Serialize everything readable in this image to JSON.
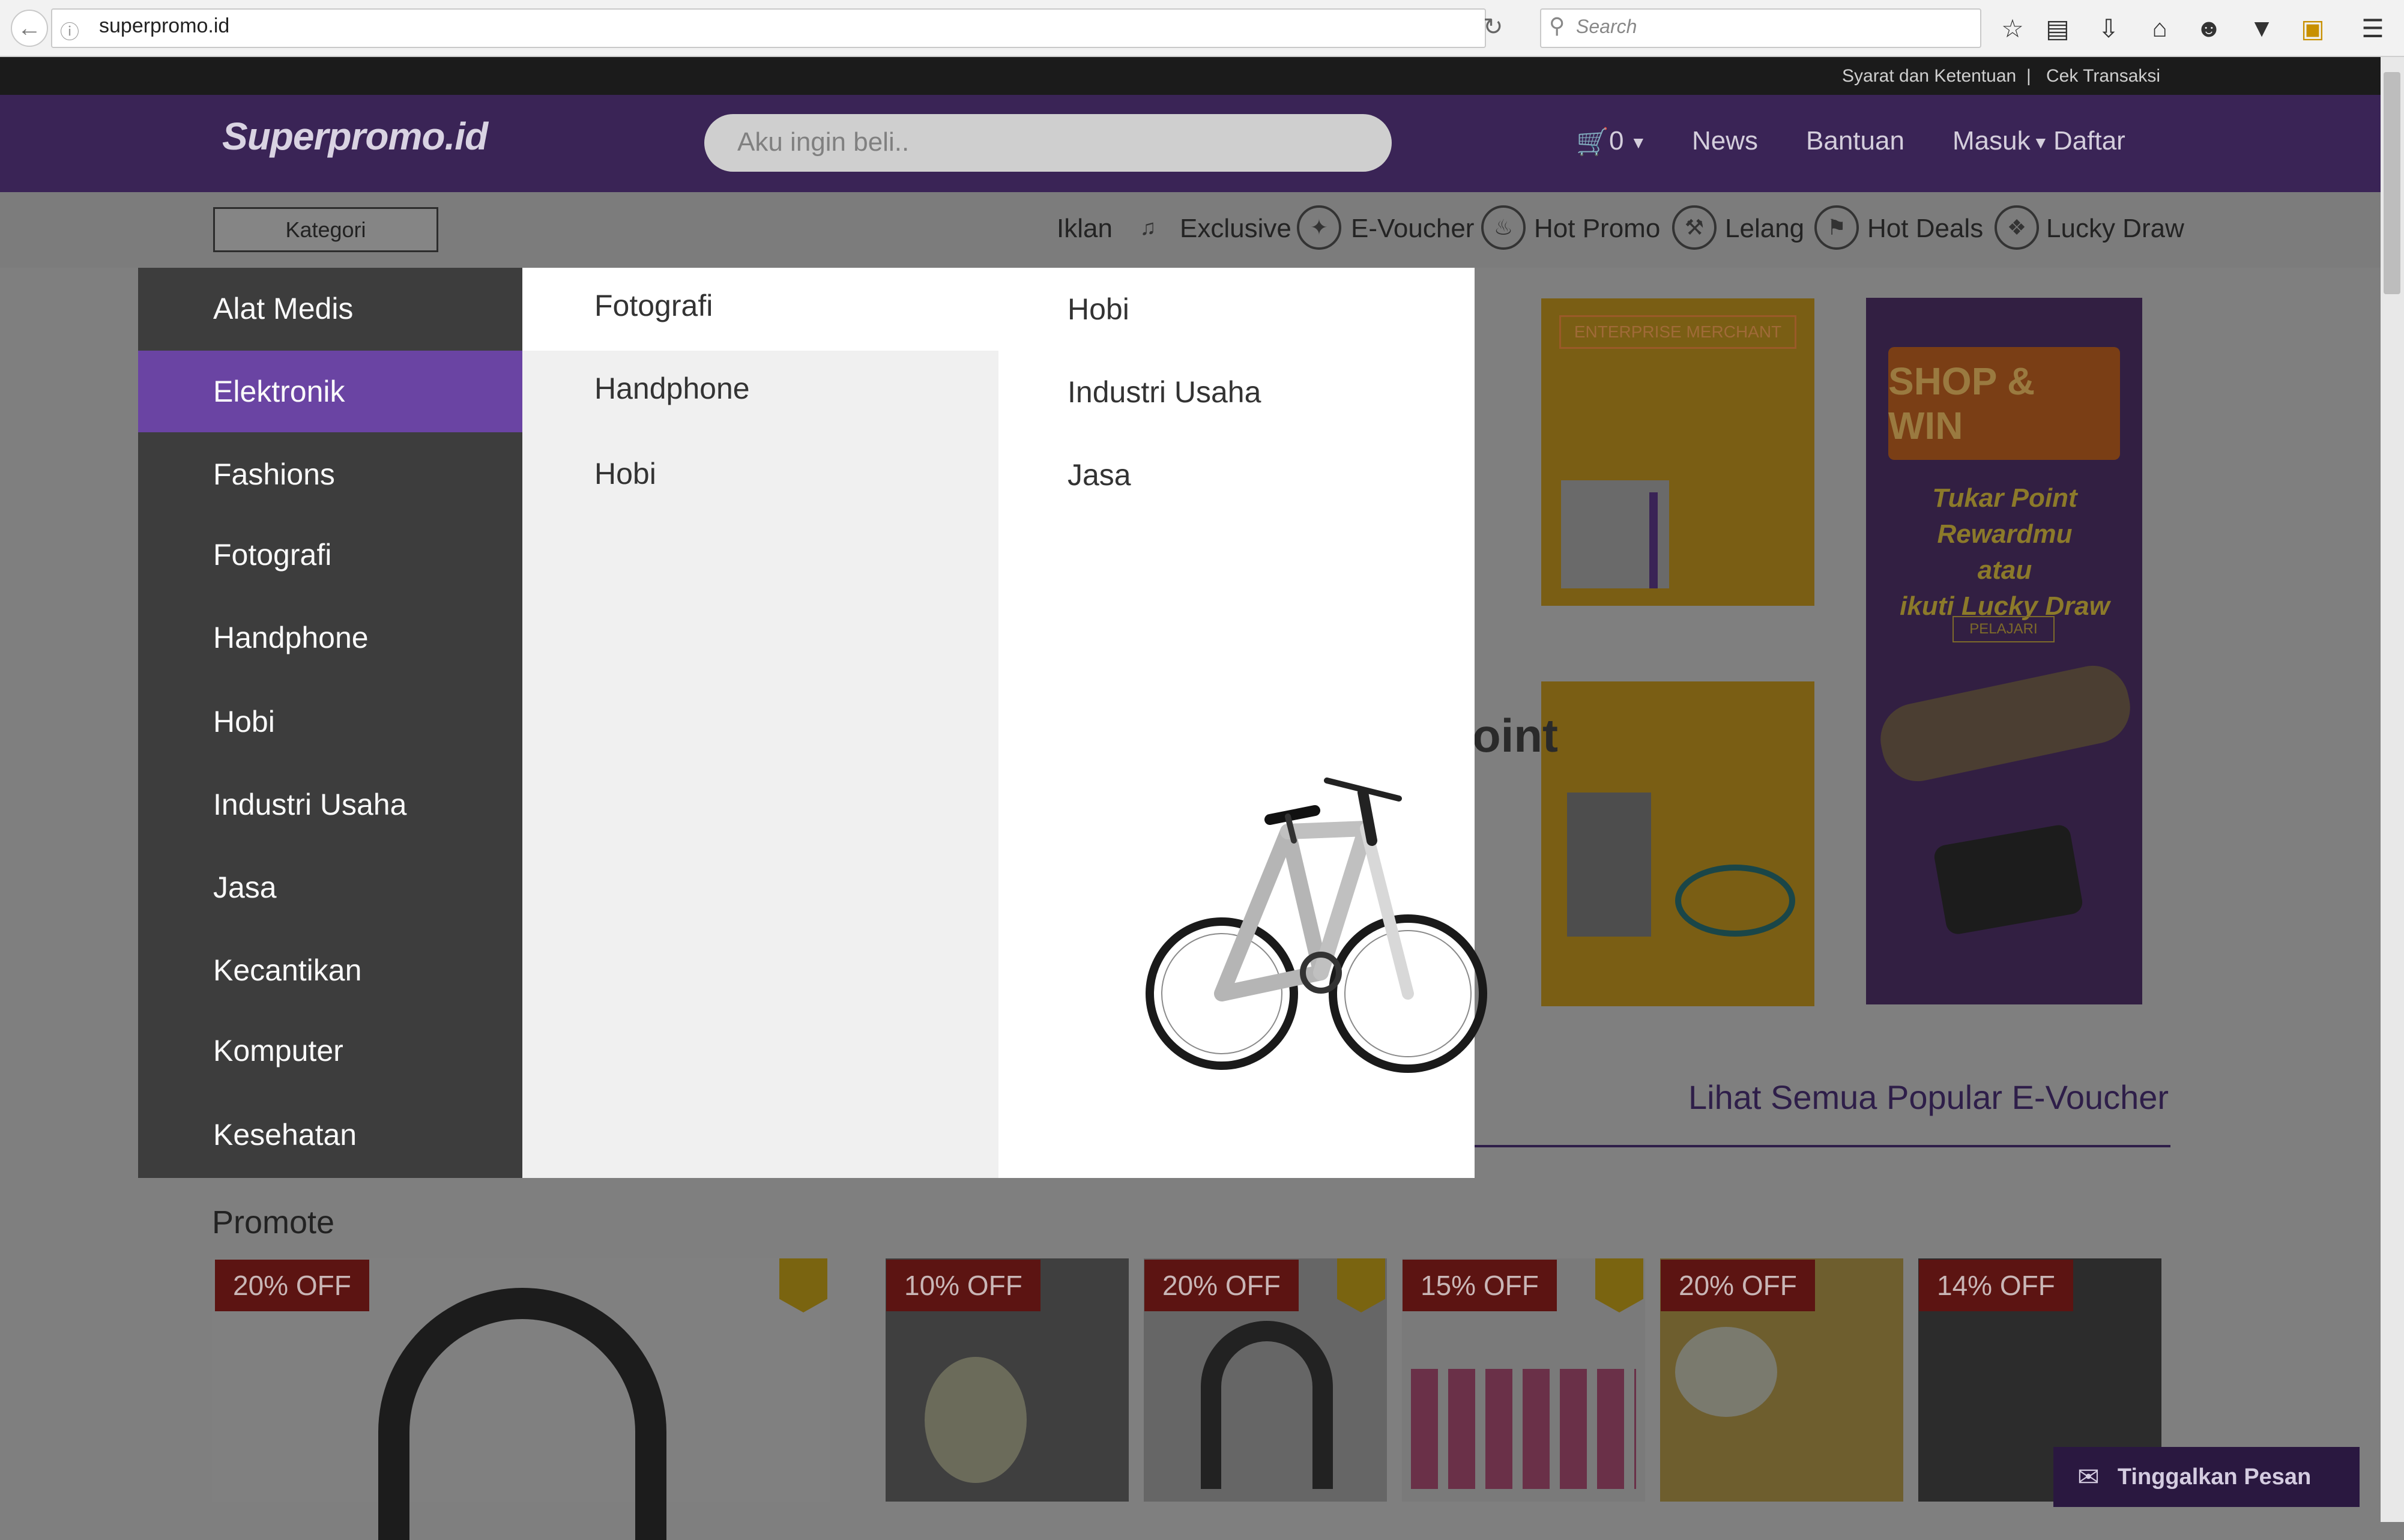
{
  "browser": {
    "url": "superpromo.id",
    "search_placeholder": "Search"
  },
  "topbar": {
    "links": [
      "Syarat dan Ketentuan",
      "|",
      "Cek Transaksi"
    ]
  },
  "header": {
    "logo_text": "Superpromo.id",
    "search_placeholder": "Aku ingin beli..",
    "cart_count": "0",
    "nav": [
      "News",
      "Bantuan",
      "Masuk",
      "Daftar"
    ]
  },
  "category_bar": {
    "kategori_label": "Kategori",
    "links": [
      "Iklan",
      "Exclusive",
      "E-Voucher",
      "Hot Promo",
      "Lelang",
      "Hot Deals",
      "Lucky Draw"
    ]
  },
  "mega_menu": {
    "categories": [
      "Alat Medis",
      "Elektronik",
      "Fashions",
      "Fotografi",
      "Handphone",
      "Hobi",
      "Industri Usaha",
      "Jasa",
      "Kecantikan",
      "Komputer",
      "Kesehatan"
    ],
    "active": "Elektronik",
    "sub_col1": [
      "Fotografi",
      "Handphone",
      "Hobi"
    ],
    "sub_col2": [
      "Hobi",
      "Industri Usaha",
      "Jasa"
    ]
  },
  "banners": {
    "enterprise": "ENTERPRISE MERCHANT",
    "shop_win": "SHOP & WIN",
    "tukar_lines": [
      "Tukar Point Rewardmu",
      "atau",
      "ikuti Lucky Draw"
    ],
    "pelajari": "PELAJARI",
    "point_text": "oint"
  },
  "main": {
    "lihat_semua": "Lihat Semua Popular E-Voucher",
    "promote_title": "Promote",
    "promo_badges": [
      "20% OFF",
      "10% OFF",
      "20% OFF",
      "15% OFF",
      "20% OFF",
      "14% OFF"
    ]
  },
  "chat_widget": {
    "label": "Tinggalkan Pesan"
  },
  "colors": {
    "purple_header": "#5b3a8a",
    "active_category": "#6a44a3",
    "menu_dark": "#3d3d3d",
    "badge_red": "#c8302a"
  }
}
